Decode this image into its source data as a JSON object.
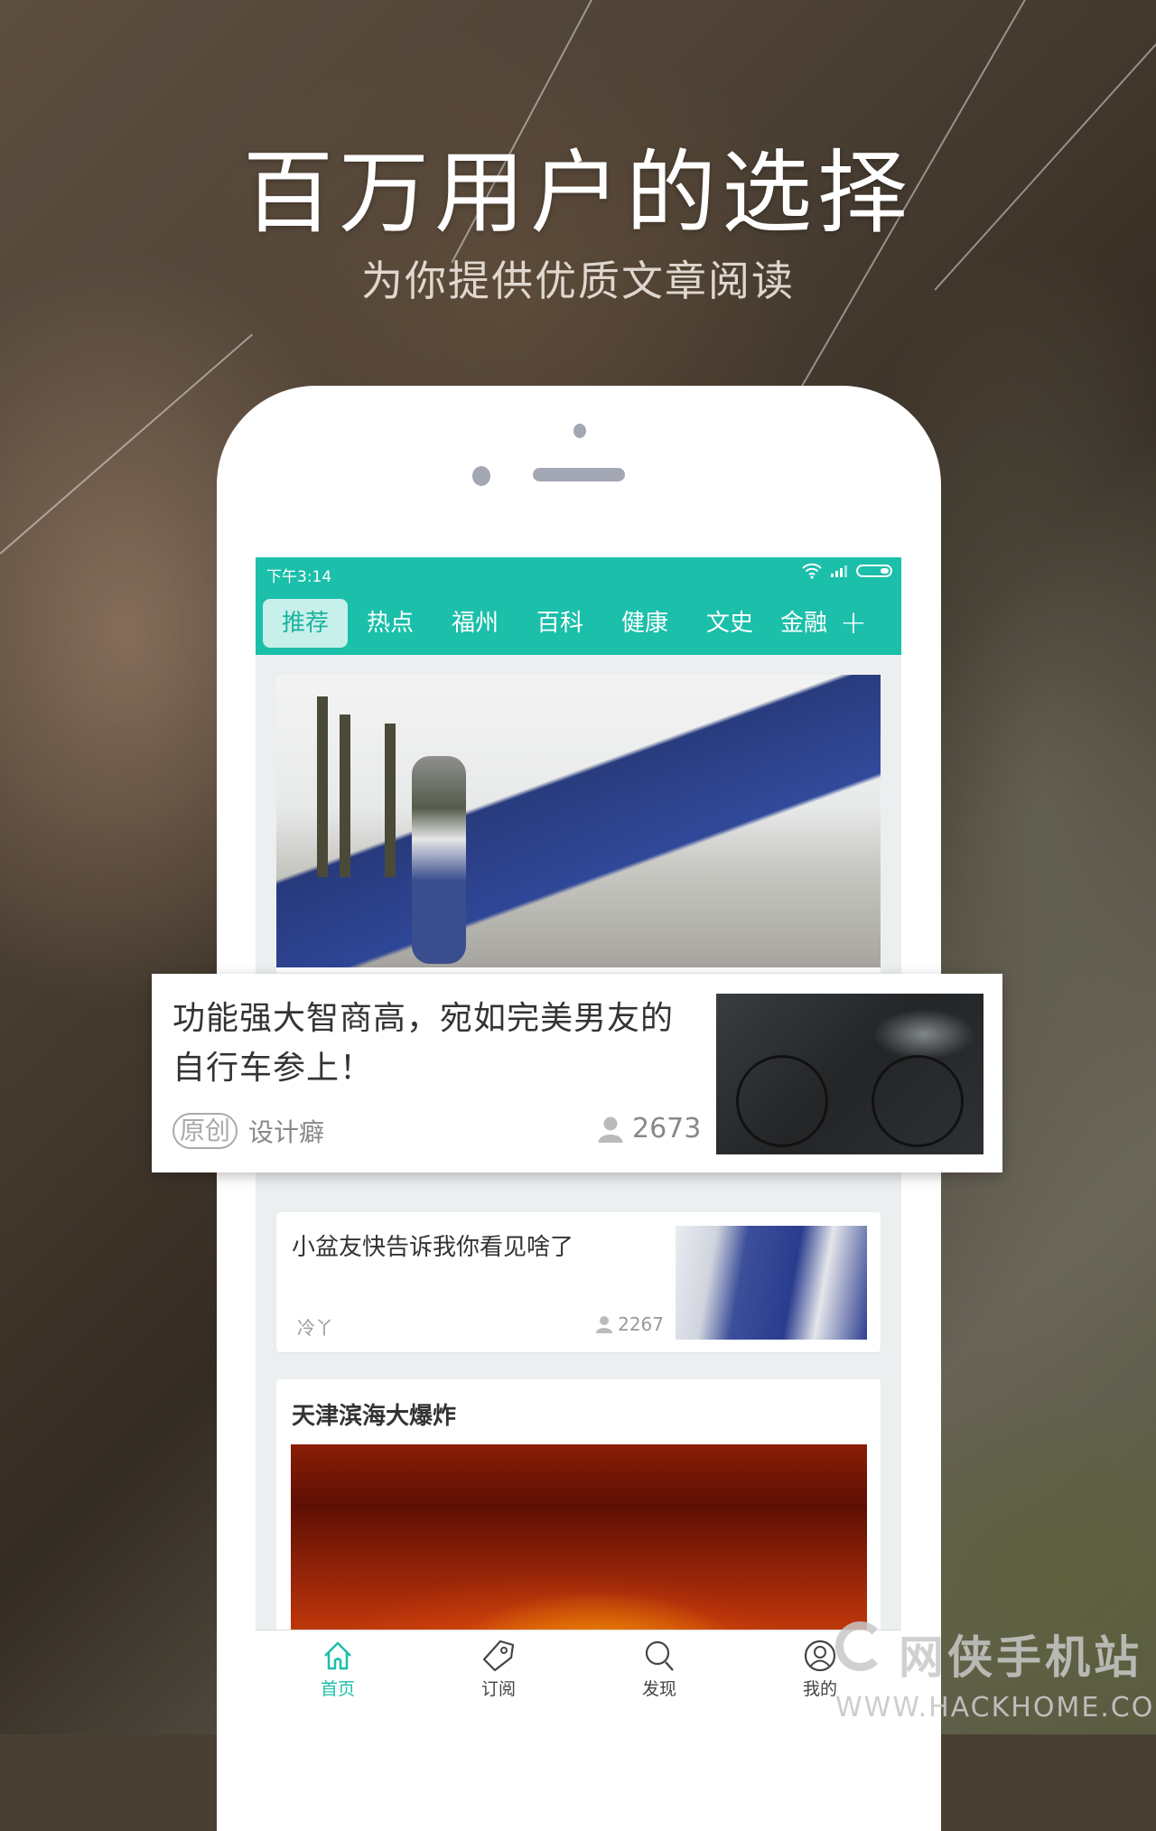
{
  "promo": {
    "headline": "百万用户的选择",
    "subheadline": "为你提供优质文章阅读"
  },
  "status_bar": {
    "time": "下午3:14",
    "icons": [
      "wifi-icon",
      "signal-icon",
      "battery-icon"
    ]
  },
  "colors": {
    "accent": "#1bbfaa",
    "active_tab_bg": "#c8f0ea"
  },
  "channels": {
    "tabs": [
      {
        "label": "推荐",
        "active": true
      },
      {
        "label": "热点",
        "active": false
      },
      {
        "label": "福州",
        "active": false
      },
      {
        "label": "百科",
        "active": false
      },
      {
        "label": "健康",
        "active": false
      },
      {
        "label": "文史",
        "active": false
      },
      {
        "label": "金融",
        "active": false
      }
    ],
    "add_label": "+"
  },
  "feed": {
    "featured_card": {
      "title": "功能强大智商高，宛如完美男友的自行车参上！",
      "badge": "原创",
      "author": "设计癖",
      "views": "2673"
    },
    "article_2": {
      "title": "小盆友快告诉我你看见啥了",
      "author": "冷丫",
      "views": "2267"
    },
    "article_3": {
      "title": "天津滨海大爆炸"
    }
  },
  "bottom_nav": {
    "items": [
      {
        "label": "首页",
        "icon": "home-icon",
        "active": true
      },
      {
        "label": "订阅",
        "icon": "tag-icon",
        "active": false
      },
      {
        "label": "发现",
        "icon": "search-icon",
        "active": false
      },
      {
        "label": "我的",
        "icon": "user-icon",
        "active": false
      }
    ]
  },
  "watermark": {
    "name": "网侠手机站",
    "url": "WWW.HACKHOME.COM"
  }
}
